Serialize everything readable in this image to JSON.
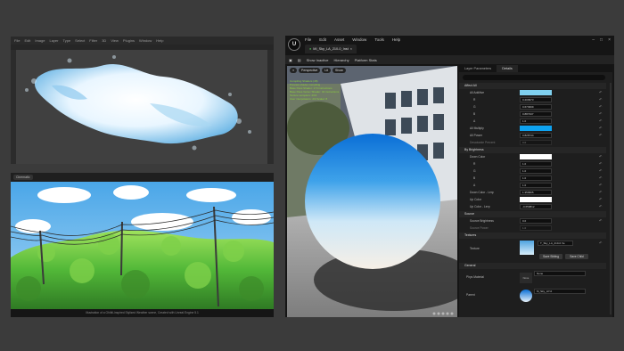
{
  "image_editor": {
    "menu": [
      "File",
      "Edit",
      "Image",
      "Layer",
      "Type",
      "Select",
      "Filter",
      "3D",
      "View",
      "Plugins",
      "Window",
      "Help"
    ]
  },
  "game": {
    "top_buttons": [
      "Cinematic",
      "",
      "Default"
    ],
    "caption": "Illustration of a Ghibli-inspired Stylized Weather scene, Created with Unreal Engine 5.1"
  },
  "editor": {
    "logo": "U",
    "menu": [
      "File",
      "Edit",
      "Asset",
      "Window",
      "Tools",
      "Help"
    ],
    "doc_tab": "MI_Sky_LA_210-0_Inst",
    "toolbar": [
      "Show Inactive",
      "Hierarchy",
      "Platform Stats"
    ],
    "viewport_buttons": [
      "Perspective",
      "Lit",
      "Show"
    ],
    "stats": [
      "Compiling Shaders (48)",
      "Preview shader compiling",
      "Base Pass Shader: 173 instructions",
      "Base Pass Vertex Shader: 34 instructions",
      "Texture samplers: 2/16",
      "User interpolators: 2/4 Scalar: 8"
    ],
    "panel_tabs": [
      "Layer Parameters",
      "Details"
    ],
    "categories": {
      "affect_all": "Affect All",
      "by_brightness": "By Brightness",
      "source": "Source",
      "textures": "Textures",
      "general": "General"
    },
    "rows": {
      "all_additive": "All Additive",
      "r1": "R",
      "g1": "G",
      "b1": "B",
      "a1": "A",
      "r1v": "0.200973",
      "g1v": "0.674999",
      "b1v": "0.887337",
      "a1v": "1.0",
      "all_multiply": "All Multiply",
      "all_power": "All Power",
      "all_power_v": "0.828744",
      "desaturate": "Desaturate Percent",
      "desaturate_v": "0.0",
      "down_color": "Down Color",
      "r2": "R",
      "g2": "G",
      "b2": "B",
      "a2": "A",
      "r2v": "1.0",
      "g2v": "1.0",
      "b2v": "1.0",
      "a2v": "1.0",
      "down_color_lerp": "Down Color - Lerp",
      "down_color_lerp_v": "1.350965",
      "up_color": "Up Color",
      "up_color_lerp": "Up Color - Lerp",
      "up_color_lerp_v": "-0.659812",
      "source_brightness": "Source Brightness",
      "source_brightness_v": "0.0",
      "source_power": "Source Power",
      "source_power_v": "1.0",
      "texture": "Texture",
      "texture_v": "T_Sky_LA_210-0 Ve",
      "save_sibling": "Save Sibling",
      "save_child": "Save Child",
      "phys_material": "Phys Material",
      "phys_material_v": "None",
      "phys_thumb": "None",
      "parent": "Parent",
      "parent_v": "M_Sky_LP-0"
    }
  },
  "colors": {
    "additive_swatch": "#7fd0ef",
    "multiply_swatch": "#0ea2f0",
    "white": "#ffffff",
    "accent": "#0070e0"
  }
}
